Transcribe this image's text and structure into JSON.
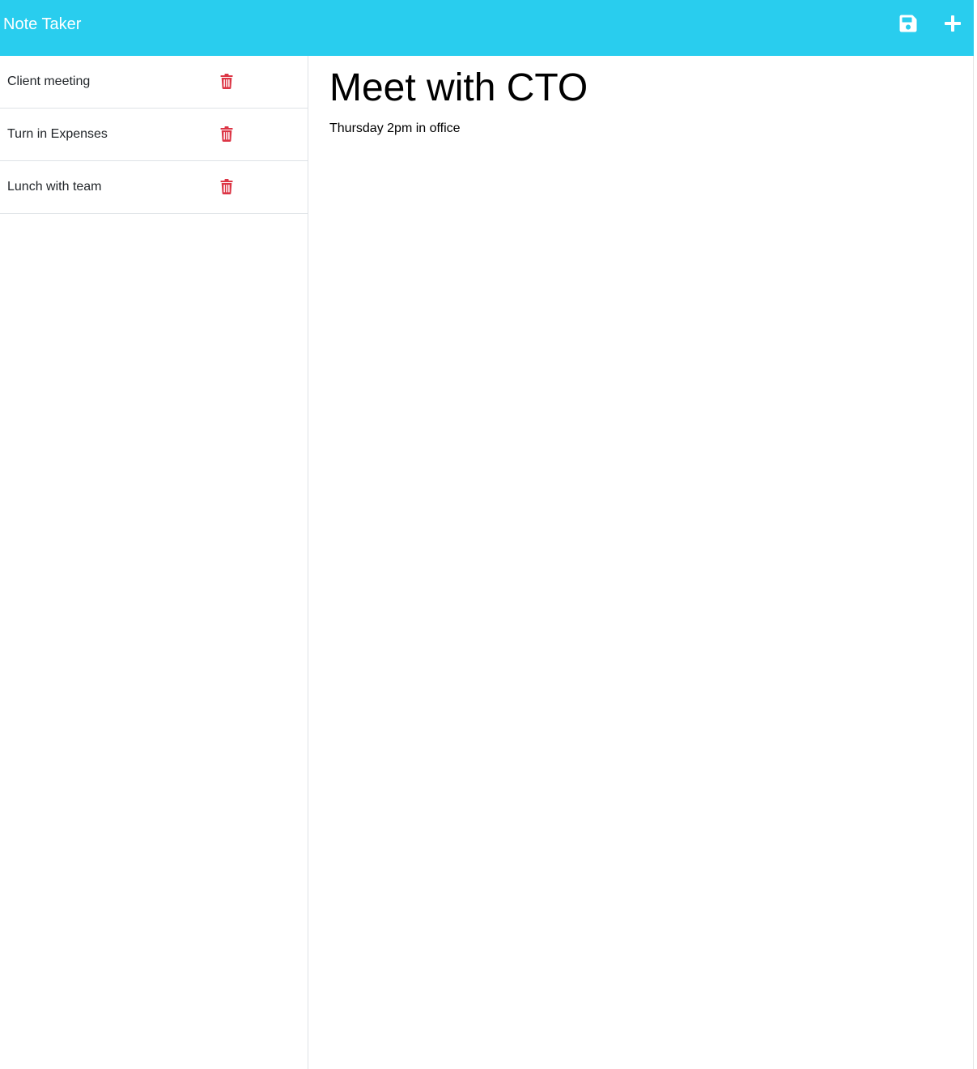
{
  "app": {
    "title": "Note Taker",
    "accent_color": "#29cdee"
  },
  "toolbar": {
    "save_icon": "floppy-disk-icon",
    "new_icon": "plus-icon"
  },
  "notes": [
    {
      "title": "Client meeting",
      "delete_icon": "trash-icon"
    },
    {
      "title": "Turn in Expenses",
      "delete_icon": "trash-icon"
    },
    {
      "title": "Lunch with team",
      "delete_icon": "trash-icon"
    }
  ],
  "delete_icon_color": "#dc3545",
  "editor": {
    "title_value": "Meet with CTO",
    "text_value": "Thursday 2pm in office"
  }
}
